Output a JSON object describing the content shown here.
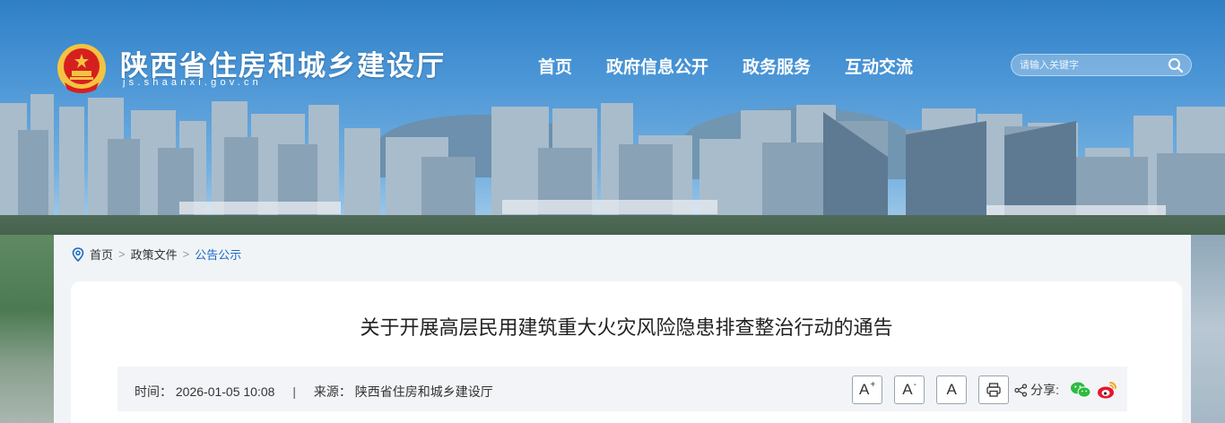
{
  "header": {
    "site_title": "陕西省住房和城乡建设厅",
    "site_domain": "js.shaanxi.gov.cn"
  },
  "nav": {
    "items": [
      "首页",
      "政府信息公开",
      "政务服务",
      "互动交流"
    ]
  },
  "search": {
    "placeholder": "请输入关键字"
  },
  "breadcrumb": {
    "home": "首页",
    "sep1": ">",
    "level1": "政策文件",
    "sep2": ">",
    "current": "公告公示"
  },
  "article": {
    "title": "关于开展高层民用建筑重大火灾风险隐患排查整治行动的通告",
    "time_label": "时间：",
    "time_value": "2026-01-05 10:08",
    "divider": "|",
    "source_label": "来源：",
    "source_value": "陕西省住房和城乡建设厅"
  },
  "tools": {
    "font_large": "A",
    "font_large_sup": "+",
    "font_small": "A",
    "font_small_sup": "-",
    "font_default": "A",
    "share_label": "分享:"
  },
  "colors": {
    "link_blue": "#1a6ac2",
    "wechat_green": "#2dbb3e",
    "weibo_red": "#e6162d"
  }
}
